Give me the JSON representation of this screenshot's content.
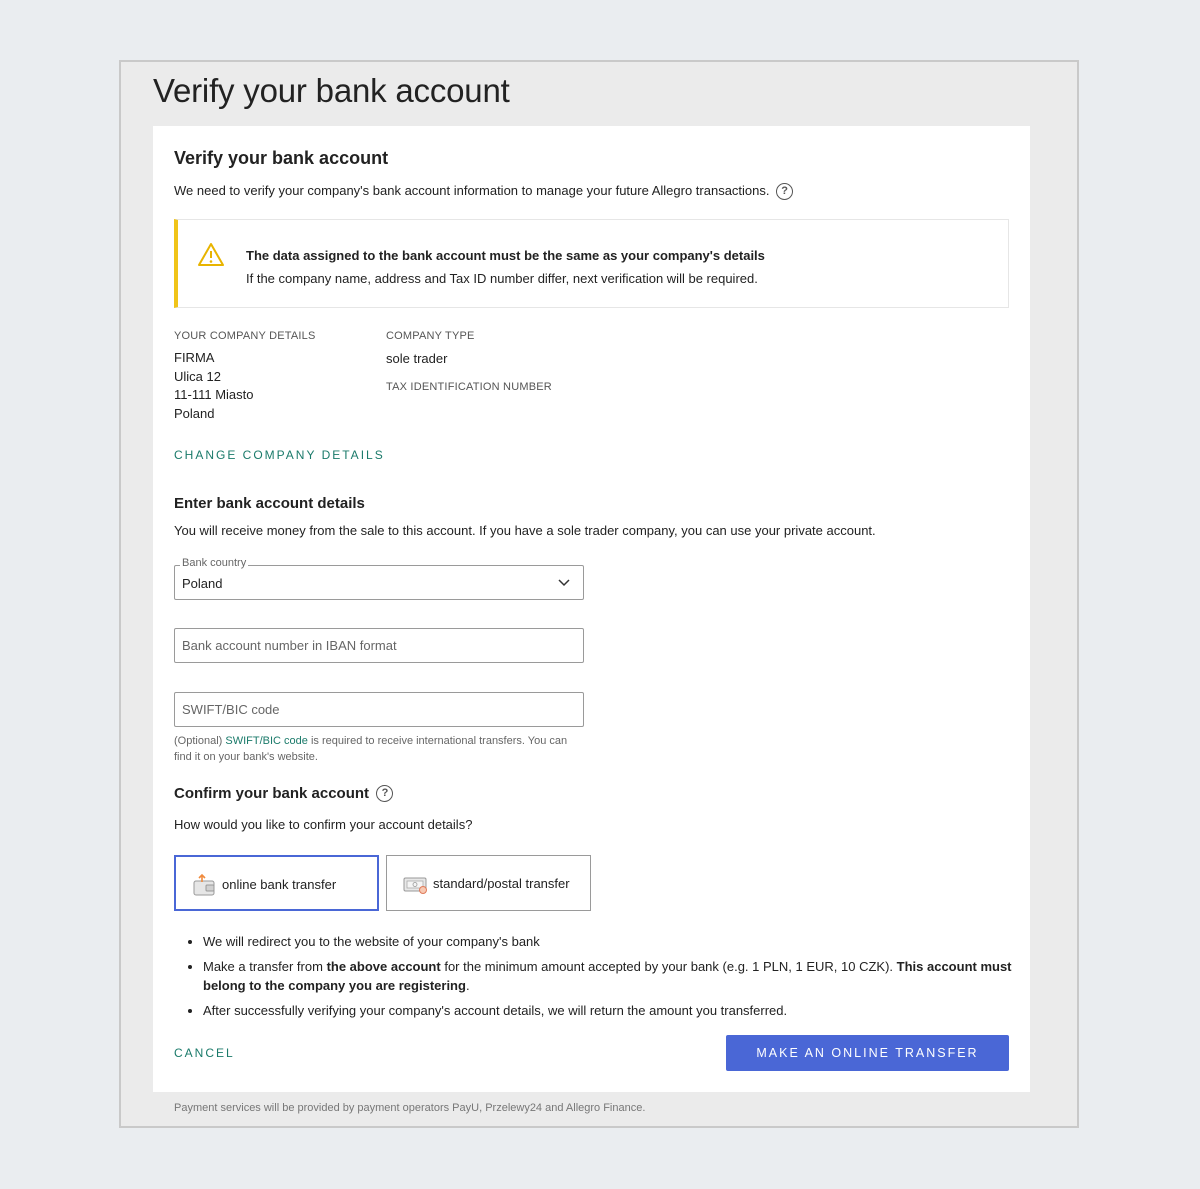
{
  "page": {
    "title": "Verify your bank account",
    "footer": "Payment services will be provided by payment operators PayU, Przelewy24 and Allegro Finance."
  },
  "card": {
    "title": "Verify your bank account",
    "intro": "We need to verify your company's bank account information to manage your future Allegro transactions.",
    "help_icon": "question-circle-icon",
    "alert": {
      "icon": "warning-triangle-icon",
      "title": "The data assigned to the bank account must be the same as your company's details",
      "body": "If the company name, address and Tax ID number differ, next verification will be required."
    },
    "company": {
      "details_label": "YOUR COMPANY DETAILS",
      "address": [
        "FIRMA",
        "Ulica 12",
        "11-111 Miasto",
        "Poland"
      ],
      "type_label": "COMPANY TYPE",
      "type_value": "sole trader",
      "tax_label": "TAX IDENTIFICATION NUMBER",
      "change_link": "CHANGE COMPANY DETAILS"
    },
    "bank_details": {
      "heading": "Enter bank account details",
      "description": "You will receive money from the sale to this account. If you have a sole trader company, you can use your private account.",
      "country_label": "Bank country",
      "country_value": "Poland",
      "iban_placeholder": "Bank account number in IBAN format",
      "swift_placeholder": "SWIFT/BIC code",
      "swift_hint_prefix": "(Optional)",
      "swift_hint_link": "SWIFT/BIC code",
      "swift_hint_rest": "is required to receive international transfers. You can",
      "swift_hint_line2": "find it on your bank's website."
    },
    "confirm": {
      "heading": "Confirm your bank account",
      "question": "How would you like to confirm your account details?",
      "options": [
        {
          "label": "online bank transfer",
          "icon": "wallet-upload-icon",
          "selected": true
        },
        {
          "label": "standard/postal transfer",
          "icon": "cash-envelope-icon",
          "selected": false
        }
      ],
      "bullets": {
        "b1": "We will redirect you to the website of your company's bank",
        "b2_pre": "Make a transfer from",
        "b2_bold1": "the above account",
        "b2_mid": "for the minimum amount accepted by your bank (e.g. 1 PLN, 1 EUR, 10 CZK).",
        "b2_bold2": "This account must belong to the company you are registering",
        "b2_end": ".",
        "b3": "After successfully verifying your company's account details, we will return the amount you transferred."
      }
    },
    "actions": {
      "cancel": "CANCEL",
      "primary": "MAKE AN ONLINE TRANSFER"
    }
  },
  "colors": {
    "accent": "#4a67d6",
    "link": "#1a7a6a",
    "warning": "#f0c419",
    "background": "#eaedf0"
  }
}
